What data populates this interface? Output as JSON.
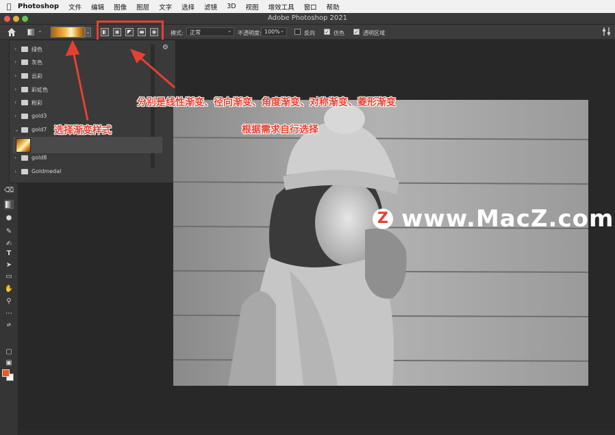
{
  "menubar": {
    "app_name": "Photoshop",
    "items": [
      "文件",
      "编辑",
      "图像",
      "图层",
      "文字",
      "选择",
      "滤镜",
      "3D",
      "视图",
      "增效工具",
      "窗口",
      "帮助"
    ]
  },
  "window": {
    "title": "Adobe Photoshop 2021"
  },
  "options": {
    "mode_label": "模式:",
    "mode_value": "正常",
    "opacity_label": "不透明度:",
    "opacity_value": "100%",
    "reverse_label": "反向",
    "dither_label": "仿色",
    "transparency_label": "透明区域",
    "reverse_checked": false,
    "dither_checked": true,
    "transparency_checked": true
  },
  "gradient_folders": [
    {
      "name": "绿色",
      "expanded": false
    },
    {
      "name": "灰色",
      "expanded": false
    },
    {
      "name": "云彩",
      "expanded": false
    },
    {
      "name": "彩虹色",
      "expanded": false
    },
    {
      "name": "粉彩",
      "expanded": false
    },
    {
      "name": "gold3",
      "expanded": false
    },
    {
      "name": "gold7",
      "expanded": true
    },
    {
      "name": "gold8",
      "expanded": false
    },
    {
      "name": "Goldmedal",
      "expanded": false
    }
  ],
  "annotations": {
    "select_style": "选择渐变样式",
    "types_line1": "分别是线性渐变、径向渐变、角度渐变、对称渐变、菱形渐变",
    "types_line2": "根据需求自行选择"
  },
  "watermark": {
    "logo": "Z",
    "text": "www.MacZ.com"
  },
  "colors": {
    "accent_red": "#e8402f",
    "foreground": "#e85b1a",
    "background": "#ffffff"
  },
  "icons": [
    "apple-icon",
    "home-icon",
    "gradient-tool-icon",
    "linear-gradient-icon",
    "radial-gradient-icon",
    "angle-gradient-icon",
    "reflected-gradient-icon",
    "diamond-gradient-icon",
    "gear-icon",
    "folder-icon",
    "eraser-icon",
    "pen-icon",
    "type-icon",
    "hand-icon",
    "zoom-icon"
  ]
}
